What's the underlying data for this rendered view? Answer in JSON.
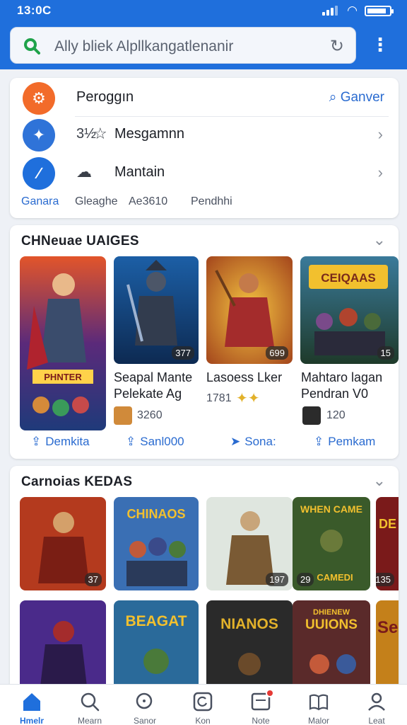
{
  "status_bar": {
    "time": "13:0C"
  },
  "search": {
    "placeholder": "Ally bliek Alpllkangatlenanir"
  },
  "quick": {
    "row1_label": "Peroggın",
    "row1_link": "Ganver",
    "row2_prefix": "3½",
    "row2_label": "Mesgamnn",
    "row3_label": "Mantain",
    "tabs": [
      "Ganara",
      "Gleaghe",
      "Ae3610",
      "Pendhhi"
    ]
  },
  "section1": {
    "title": "CHNeuae UAIGES",
    "games": [
      {
        "name_line1": "",
        "name_line2": "",
        "meta": "",
        "badge": "",
        "poster_text": "PHNTER"
      },
      {
        "name_line1": "Seapal Mante",
        "name_line2": "Pelekate Ag",
        "meta": "3260",
        "badge": "377"
      },
      {
        "name_line1": "Lasoess Lker",
        "name_line2": "",
        "meta": "1781",
        "badge": "699"
      },
      {
        "name_line1": "Mahtaro lagan",
        "name_line2": "Pendran V0",
        "meta": "120",
        "badge": "15",
        "poster_text": "CEIQAAS"
      }
    ],
    "actions": [
      "Demkita",
      "Sanl000",
      "Sona:",
      "Pemkam"
    ]
  },
  "section2": {
    "title": "Carnoias KEDAS",
    "games_row1": [
      {
        "badge": "37"
      },
      {
        "badge": "",
        "poster_text": "CHINAOS"
      },
      {
        "badge": "197"
      },
      {
        "badge": "29",
        "poster_text": "WHEN CAME",
        "sub_text": "CAMEDI"
      },
      {
        "badge": "135",
        "poster_text": "DE"
      }
    ],
    "games_row2": [
      {
        "poster_text": ""
      },
      {
        "poster_text": "BEAGAT"
      },
      {
        "poster_text": "NIANOS"
      },
      {
        "poster_text": "UUIONS",
        "sub_text": "DHIENEW"
      },
      {
        "poster_text": "Se"
      }
    ]
  },
  "bottom_nav": [
    {
      "label": "Hmelr",
      "icon": "home-icon"
    },
    {
      "label": "Mearn",
      "icon": "search-icon"
    },
    {
      "label": "Sanor",
      "icon": "discover-icon"
    },
    {
      "label": "Kon",
      "icon": "refresh-icon"
    },
    {
      "label": "Note",
      "icon": "inbox-icon"
    },
    {
      "label": "Malor",
      "icon": "book-icon"
    },
    {
      "label": "Leat",
      "icon": "profile-icon"
    }
  ],
  "colors": {
    "accent": "#1f6fdc",
    "link": "#2a6bd0"
  }
}
